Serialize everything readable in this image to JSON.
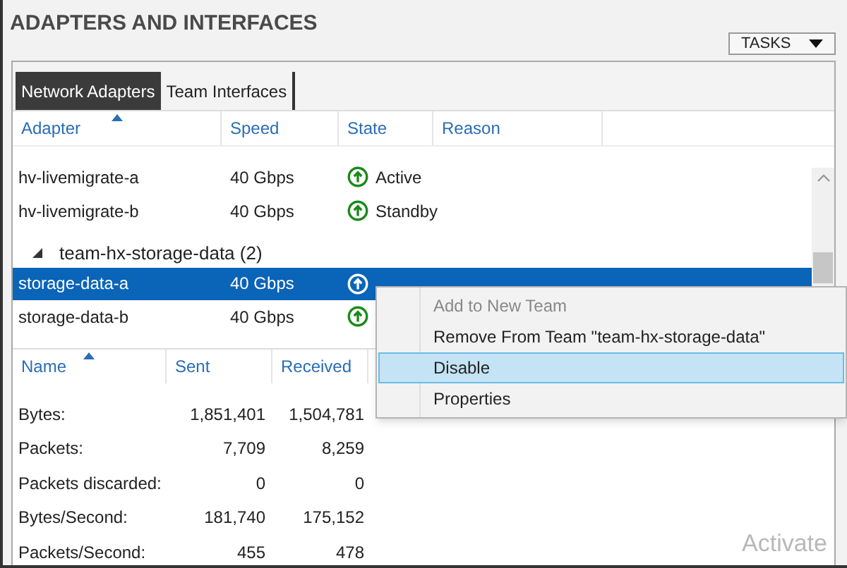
{
  "title": "ADAPTERS AND INTERFACES",
  "tasks_button": {
    "label": "TASKS"
  },
  "tabs": [
    {
      "label": "Network Adapters",
      "selected": true
    },
    {
      "label": "Team Interfaces",
      "selected": false
    }
  ],
  "adapters": {
    "columns": [
      {
        "label": "Adapter",
        "sorted": true
      },
      {
        "label": "Speed",
        "sorted": false
      },
      {
        "label": "State",
        "sorted": false
      },
      {
        "label": "Reason",
        "sorted": false
      }
    ],
    "rows": [
      {
        "kind": "adapter",
        "name": "hv-livemigrate-a",
        "speed": "40 Gbps",
        "state": "Active",
        "selected": false
      },
      {
        "kind": "adapter",
        "name": "hv-livemigrate-b",
        "speed": "40 Gbps",
        "state": "Standby",
        "selected": false
      },
      {
        "kind": "group",
        "name": "team-hx-storage-data (2)",
        "expanded": true
      },
      {
        "kind": "adapter",
        "name": "storage-data-a",
        "speed": "40 Gbps",
        "selected": true
      },
      {
        "kind": "adapter",
        "name": "storage-data-b",
        "speed": "40 Gbps",
        "selected": false
      }
    ]
  },
  "stats": {
    "columns": [
      {
        "label": "Name",
        "sorted": true
      },
      {
        "label": "Sent",
        "sorted": false
      },
      {
        "label": "Received",
        "sorted": false
      }
    ],
    "rows": [
      {
        "label": "Bytes:",
        "sent": "1,851,401",
        "received": "1,504,781"
      },
      {
        "label": "Packets:",
        "sent": "7,709",
        "received": "8,259"
      },
      {
        "label": "Packets discarded:",
        "sent": "0",
        "received": "0"
      },
      {
        "label": "Bytes/Second:",
        "sent": "181,740",
        "received": "175,152"
      },
      {
        "label": "Packets/Second:",
        "sent": "455",
        "received": "478"
      }
    ]
  },
  "context_menu": [
    {
      "label": "Add to New Team",
      "disabled": true,
      "selected": false
    },
    {
      "label": "Remove From Team \"team-hx-storage-data\"",
      "disabled": false,
      "selected": false
    },
    {
      "label": "Disable",
      "disabled": false,
      "selected": true
    },
    {
      "label": "Properties",
      "disabled": false,
      "selected": false
    }
  ],
  "activation_notice": "Activate"
}
